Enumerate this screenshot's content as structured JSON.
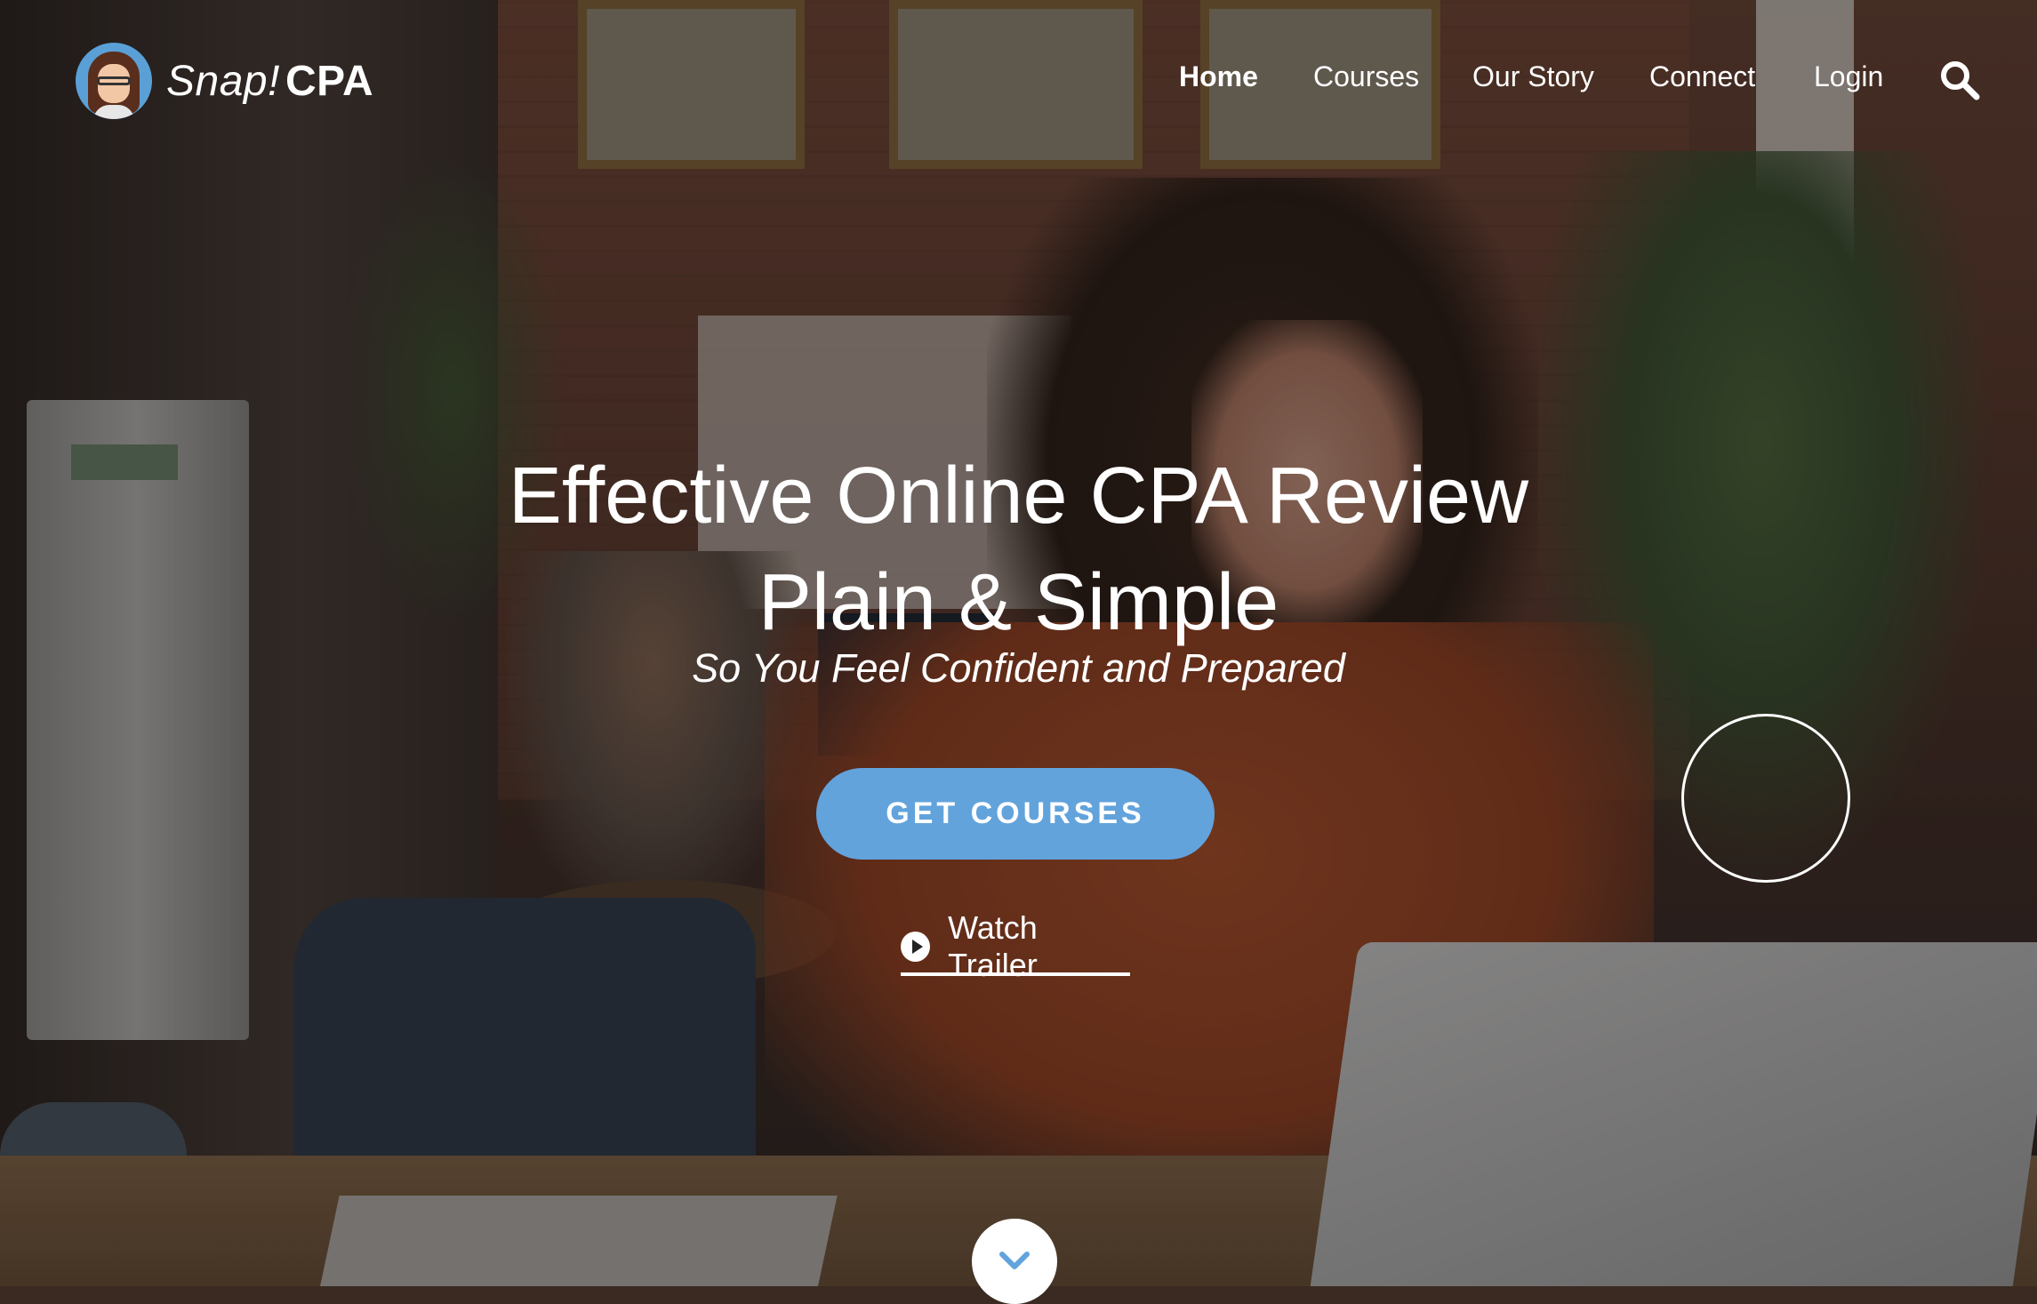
{
  "brand": {
    "name_italic": "Snap!",
    "name_bold": "CPA",
    "logo_icon": "avatar-cartoon-woman-icon"
  },
  "nav": {
    "items": [
      {
        "label": "Home",
        "active": true
      },
      {
        "label": "Courses",
        "active": false
      },
      {
        "label": "Our Story",
        "active": false
      },
      {
        "label": "Connect",
        "active": false
      },
      {
        "label": "Login",
        "active": false
      }
    ],
    "search_icon": "search-icon"
  },
  "hero": {
    "title_line1": "Effective Online CPA Review",
    "title_line2": "Plain & Simple",
    "subtitle": "So You Feel Confident and Prepared",
    "cta_label": "GET COURSES",
    "trailer_label": "Watch Trailer",
    "trailer_icon": "play-circle-icon",
    "scroll_icon": "chevron-down-icon"
  },
  "colors": {
    "accent": "#62a3dc",
    "text": "#ffffff"
  }
}
